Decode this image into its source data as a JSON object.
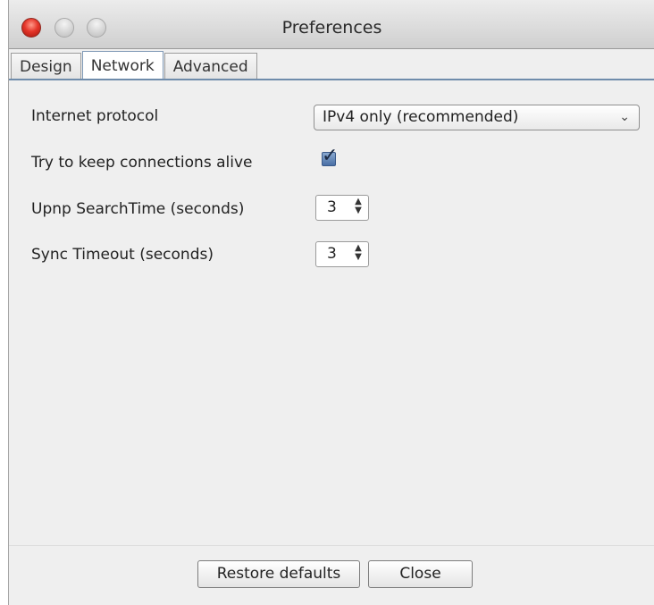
{
  "window": {
    "title": "Preferences"
  },
  "tabs": [
    {
      "label": "Design",
      "active": false
    },
    {
      "label": "Network",
      "active": true
    },
    {
      "label": "Advanced",
      "active": false
    }
  ],
  "network": {
    "internet_protocol": {
      "label": "Internet protocol",
      "selected": "IPv4 only (recommended)"
    },
    "keep_alive": {
      "label": "Try to keep connections alive",
      "checked": true
    },
    "upnp_search_time": {
      "label": "Upnp SearchTime (seconds)",
      "value": "3"
    },
    "sync_timeout": {
      "label": "Sync Timeout (seconds)",
      "value": "3"
    }
  },
  "footer": {
    "restore_label": "Restore defaults",
    "close_label": "Close"
  },
  "colors": {
    "close_button": "#e5362a",
    "tab_accent": "#6f8cab",
    "checkbox": "#4a6fa5"
  }
}
